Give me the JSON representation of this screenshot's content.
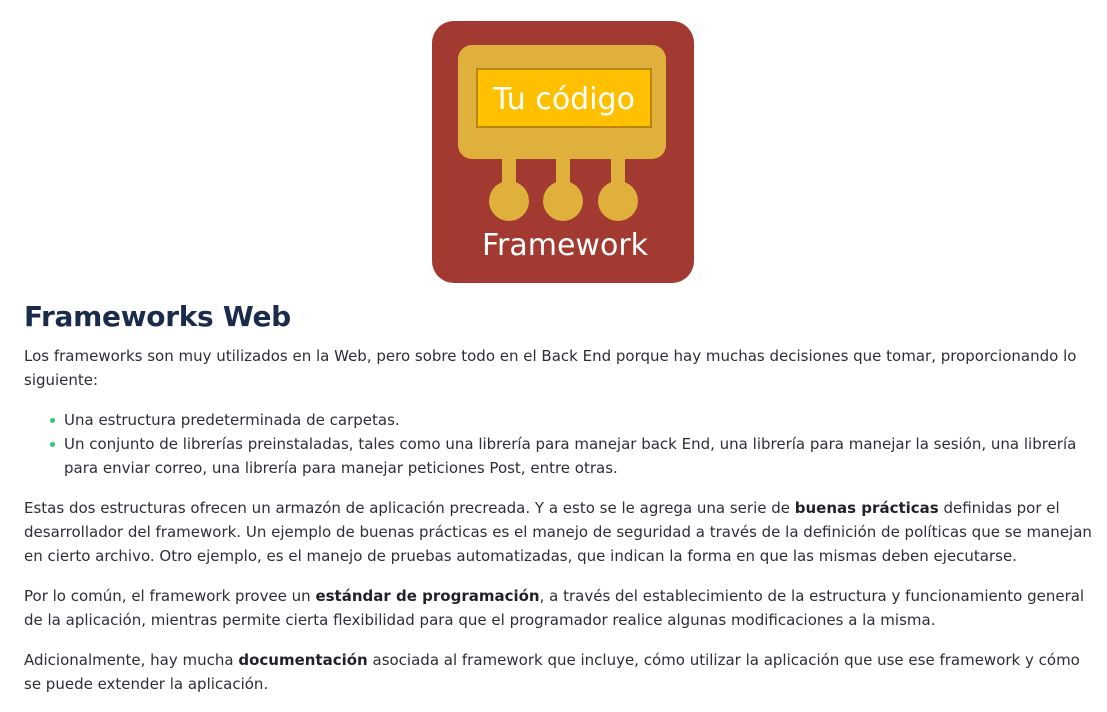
{
  "illustration": {
    "code_label": "Tu código",
    "framework_label": "Framework",
    "colors": {
      "outer": "#a33a31",
      "inner": "#e0b03d",
      "code_box": "#ffc000",
      "code_box_border": "#b8860b",
      "label_text": "#ffffff"
    }
  },
  "article": {
    "title": "Frameworks Web",
    "intro": "Los frameworks son muy utilizados en la Web, pero sobre todo en el Back End porque hay muchas decisiones que tomar, proporcionando lo siguiente:",
    "list": [
      "Una estructura predeterminada de carpetas.",
      "Un conjunto de librerías preinstaladas, tales como una librería para manejar back End, una librería para manejar la sesión, una librería para enviar correo, una librería para manejar peticiones Post, entre otras."
    ],
    "p2": {
      "before": "Estas dos estructuras ofrecen un armazón de aplicación precreada. Y a esto se le agrega una serie de ",
      "bold": "buenas prácticas",
      "after": " definidas por el desarrollador del framework. Un ejemplo de buenas prácticas es el manejo de seguridad a través de la definición de políticas que se manejan en cierto archivo. Otro ejemplo, es el manejo de pruebas automatizadas, que indican la forma en que las mismas deben ejecutarse."
    },
    "p3": {
      "before": "Por lo común, el framework provee un ",
      "bold": "estándar de programación",
      "after": ", a través del establecimiento de la estructura y funcionamiento general de la aplicación, mientras permite cierta flexibilidad para que el programador realice algunas modificaciones a la misma."
    },
    "p4": {
      "before": "Adicionalmente, hay mucha ",
      "bold": "documentación",
      "after": " asociada al framework que incluye, cómo utilizar la aplicación que use ese framework y cómo se puede extender la aplicación."
    }
  }
}
